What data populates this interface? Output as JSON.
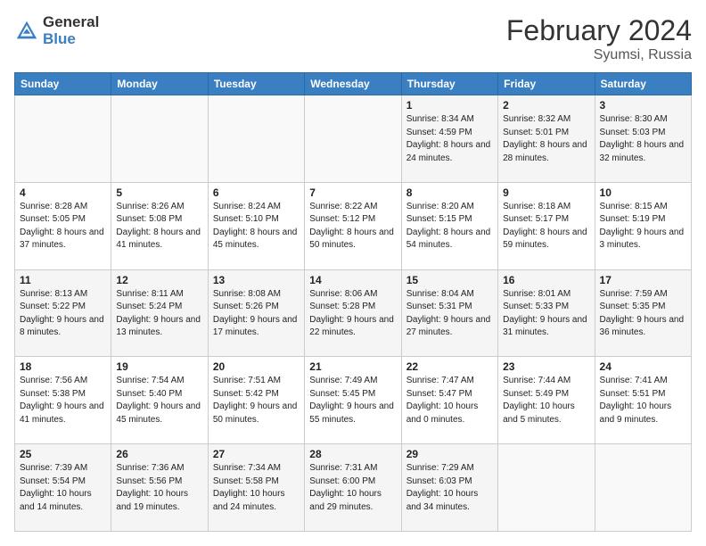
{
  "header": {
    "logo": {
      "general": "General",
      "blue": "Blue"
    },
    "title": "February 2024",
    "location": "Syumsi, Russia"
  },
  "days_of_week": [
    "Sunday",
    "Monday",
    "Tuesday",
    "Wednesday",
    "Thursday",
    "Friday",
    "Saturday"
  ],
  "weeks": [
    [
      {
        "day": "",
        "info": ""
      },
      {
        "day": "",
        "info": ""
      },
      {
        "day": "",
        "info": ""
      },
      {
        "day": "",
        "info": ""
      },
      {
        "day": "1",
        "info": "Sunrise: 8:34 AM\nSunset: 4:59 PM\nDaylight: 8 hours\nand 24 minutes."
      },
      {
        "day": "2",
        "info": "Sunrise: 8:32 AM\nSunset: 5:01 PM\nDaylight: 8 hours\nand 28 minutes."
      },
      {
        "day": "3",
        "info": "Sunrise: 8:30 AM\nSunset: 5:03 PM\nDaylight: 8 hours\nand 32 minutes."
      }
    ],
    [
      {
        "day": "4",
        "info": "Sunrise: 8:28 AM\nSunset: 5:05 PM\nDaylight: 8 hours\nand 37 minutes."
      },
      {
        "day": "5",
        "info": "Sunrise: 8:26 AM\nSunset: 5:08 PM\nDaylight: 8 hours\nand 41 minutes."
      },
      {
        "day": "6",
        "info": "Sunrise: 8:24 AM\nSunset: 5:10 PM\nDaylight: 8 hours\nand 45 minutes."
      },
      {
        "day": "7",
        "info": "Sunrise: 8:22 AM\nSunset: 5:12 PM\nDaylight: 8 hours\nand 50 minutes."
      },
      {
        "day": "8",
        "info": "Sunrise: 8:20 AM\nSunset: 5:15 PM\nDaylight: 8 hours\nand 54 minutes."
      },
      {
        "day": "9",
        "info": "Sunrise: 8:18 AM\nSunset: 5:17 PM\nDaylight: 8 hours\nand 59 minutes."
      },
      {
        "day": "10",
        "info": "Sunrise: 8:15 AM\nSunset: 5:19 PM\nDaylight: 9 hours\nand 3 minutes."
      }
    ],
    [
      {
        "day": "11",
        "info": "Sunrise: 8:13 AM\nSunset: 5:22 PM\nDaylight: 9 hours\nand 8 minutes."
      },
      {
        "day": "12",
        "info": "Sunrise: 8:11 AM\nSunset: 5:24 PM\nDaylight: 9 hours\nand 13 minutes."
      },
      {
        "day": "13",
        "info": "Sunrise: 8:08 AM\nSunset: 5:26 PM\nDaylight: 9 hours\nand 17 minutes."
      },
      {
        "day": "14",
        "info": "Sunrise: 8:06 AM\nSunset: 5:28 PM\nDaylight: 9 hours\nand 22 minutes."
      },
      {
        "day": "15",
        "info": "Sunrise: 8:04 AM\nSunset: 5:31 PM\nDaylight: 9 hours\nand 27 minutes."
      },
      {
        "day": "16",
        "info": "Sunrise: 8:01 AM\nSunset: 5:33 PM\nDaylight: 9 hours\nand 31 minutes."
      },
      {
        "day": "17",
        "info": "Sunrise: 7:59 AM\nSunset: 5:35 PM\nDaylight: 9 hours\nand 36 minutes."
      }
    ],
    [
      {
        "day": "18",
        "info": "Sunrise: 7:56 AM\nSunset: 5:38 PM\nDaylight: 9 hours\nand 41 minutes."
      },
      {
        "day": "19",
        "info": "Sunrise: 7:54 AM\nSunset: 5:40 PM\nDaylight: 9 hours\nand 45 minutes."
      },
      {
        "day": "20",
        "info": "Sunrise: 7:51 AM\nSunset: 5:42 PM\nDaylight: 9 hours\nand 50 minutes."
      },
      {
        "day": "21",
        "info": "Sunrise: 7:49 AM\nSunset: 5:45 PM\nDaylight: 9 hours\nand 55 minutes."
      },
      {
        "day": "22",
        "info": "Sunrise: 7:47 AM\nSunset: 5:47 PM\nDaylight: 10 hours\nand 0 minutes."
      },
      {
        "day": "23",
        "info": "Sunrise: 7:44 AM\nSunset: 5:49 PM\nDaylight: 10 hours\nand 5 minutes."
      },
      {
        "day": "24",
        "info": "Sunrise: 7:41 AM\nSunset: 5:51 PM\nDaylight: 10 hours\nand 9 minutes."
      }
    ],
    [
      {
        "day": "25",
        "info": "Sunrise: 7:39 AM\nSunset: 5:54 PM\nDaylight: 10 hours\nand 14 minutes."
      },
      {
        "day": "26",
        "info": "Sunrise: 7:36 AM\nSunset: 5:56 PM\nDaylight: 10 hours\nand 19 minutes."
      },
      {
        "day": "27",
        "info": "Sunrise: 7:34 AM\nSunset: 5:58 PM\nDaylight: 10 hours\nand 24 minutes."
      },
      {
        "day": "28",
        "info": "Sunrise: 7:31 AM\nSunset: 6:00 PM\nDaylight: 10 hours\nand 29 minutes."
      },
      {
        "day": "29",
        "info": "Sunrise: 7:29 AM\nSunset: 6:03 PM\nDaylight: 10 hours\nand 34 minutes."
      },
      {
        "day": "",
        "info": ""
      },
      {
        "day": "",
        "info": ""
      }
    ]
  ]
}
